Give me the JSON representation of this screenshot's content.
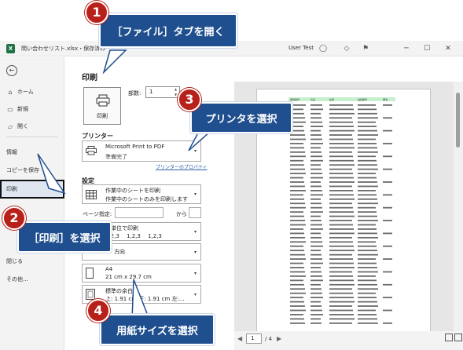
{
  "window": {
    "title": "問い合わせリスト.xlsx・保存済み",
    "user": "User Test",
    "app_icon_letter": "X",
    "app_color": "#1e7145"
  },
  "sidebar": {
    "items": [
      {
        "label": "ホーム",
        "icon": "home-icon"
      },
      {
        "label": "新規",
        "icon": "new-file-icon"
      },
      {
        "label": "開く",
        "icon": "folder-open-icon"
      },
      {
        "label": "情報"
      },
      {
        "label": "コピーを保存"
      },
      {
        "label": "印刷"
      },
      {
        "label": "閉じる"
      },
      {
        "label": "その他..."
      }
    ]
  },
  "print_panel": {
    "title": "印刷",
    "print_button": "印刷",
    "copies_label": "部数:",
    "copies_value": "1"
  },
  "printer": {
    "section_label": "プリンター",
    "name": "Microsoft Print to PDF",
    "status": "準備完了",
    "properties_link": "プリンターのプロパティ"
  },
  "settings": {
    "section_label": "設定",
    "sheet_line1": "作業中のシートを印刷",
    "sheet_line2": "作業中のシートのみを印刷します",
    "pages_label": "ページ指定:",
    "pages_to_label": "から",
    "collate_line1": "部単位で印刷",
    "collate_line2": "1,2,3　 1,2,3　 1,2,3",
    "orientation": "方向",
    "paper_line1": "A4",
    "paper_line2": "21 cm x 29.7 cm",
    "margin_line1": "標準の余白",
    "margin_line2": "上: 1.91 cm 下: 1.91 cm 左:..."
  },
  "preview": {
    "current_page": "1",
    "total_pages": "/ 4",
    "header_color": "#c6efce",
    "columns": [
      "登録番号",
      "氏名",
      "住所",
      "電話番号",
      "備考"
    ]
  },
  "callouts": {
    "step1": {
      "number": "1",
      "text": "［ファイル］タブを開く"
    },
    "step2": {
      "number": "2",
      "text": "［印刷］を選択"
    },
    "step3": {
      "number": "3",
      "text": "プリンタを選択"
    },
    "step4": {
      "number": "4",
      "text": "用紙サイズを選択"
    },
    "box_color": "#1f4f8f",
    "number_color": "#b8211a"
  }
}
